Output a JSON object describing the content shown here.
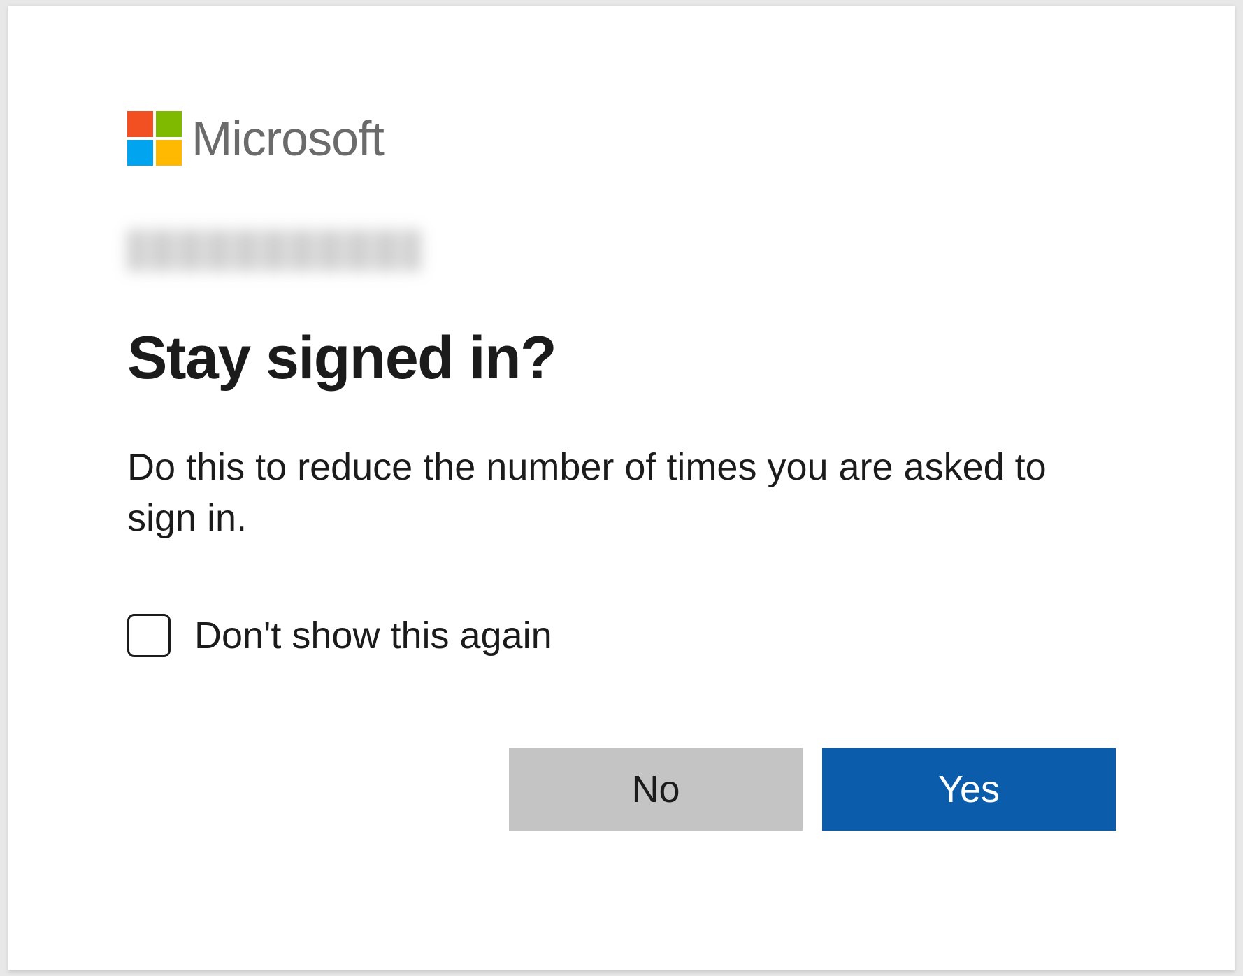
{
  "brand": {
    "name": "Microsoft",
    "logo_colors": {
      "top_left": "#f25022",
      "top_right": "#7fba00",
      "bottom_left": "#00a4ef",
      "bottom_right": "#ffb900"
    }
  },
  "identity": {
    "display": "redacted"
  },
  "dialog": {
    "title": "Stay signed in?",
    "description": "Do this to reduce the number of times you are asked to sign in."
  },
  "checkbox": {
    "label": "Don't show this again",
    "checked": false
  },
  "buttons": {
    "secondary": "No",
    "primary": "Yes"
  },
  "colors": {
    "primary_button_bg": "#0b5cab",
    "secondary_button_bg": "#c4c4c4"
  }
}
